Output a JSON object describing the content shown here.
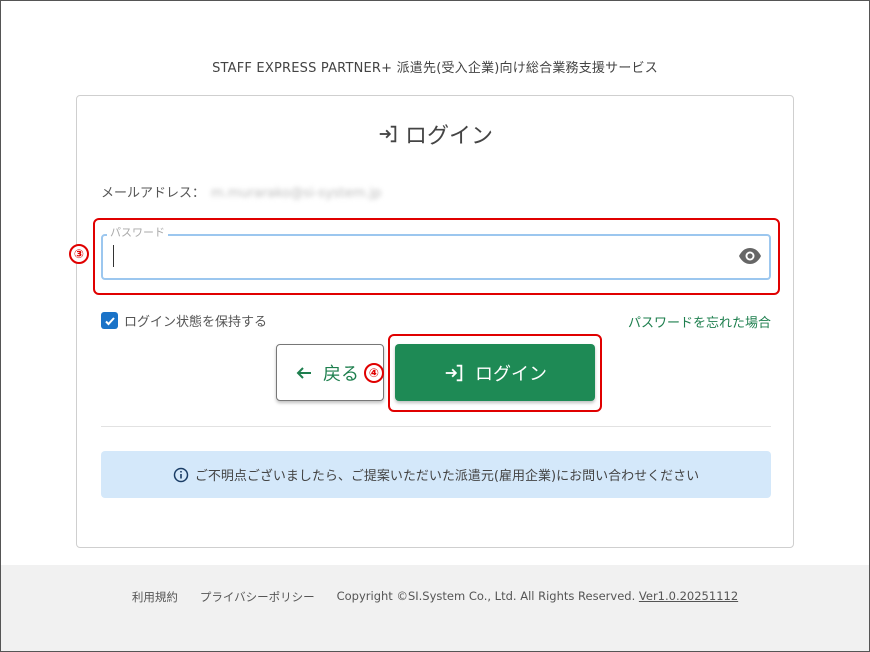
{
  "header": {
    "service_title": "STAFF EXPRESS PARTNER+ 派遣先(受入企業)向け総合業務支援サービス"
  },
  "login": {
    "heading": "ログイン",
    "email_label": "メールアドレス：",
    "email_value": "m.murarako@si-system.jp",
    "password": {
      "label": "パスワード",
      "value": "",
      "placeholder": ""
    },
    "remember_label": "ログイン状態を保持する",
    "remember_checked": true,
    "forgot_link": "パスワードを忘れた場合",
    "back_button": "戻る",
    "login_button": "ログイン"
  },
  "annotations": {
    "step3": "③",
    "step4": "④",
    "highlight_color": "#e00000"
  },
  "info": {
    "message": "ご不明点ございましたら、ご提案いただいた派遣元(雇用企業)にお問い合わせください"
  },
  "footer": {
    "terms": "利用規約",
    "privacy": "プライバシーポリシー",
    "copyright": "Copyright ©SI.System Co., Ltd. All Rights Reserved.",
    "version": "Ver1.0.20251112"
  },
  "colors": {
    "primary": "#1e8a55",
    "link": "#1e7f4e",
    "checkbox": "#1a73c8",
    "info_bg": "#d4e8fa",
    "focus_border": "#9cc7ef"
  },
  "icons": [
    "sign-in-icon",
    "eye-icon",
    "check-icon",
    "arrow-left-icon",
    "info-icon"
  ]
}
